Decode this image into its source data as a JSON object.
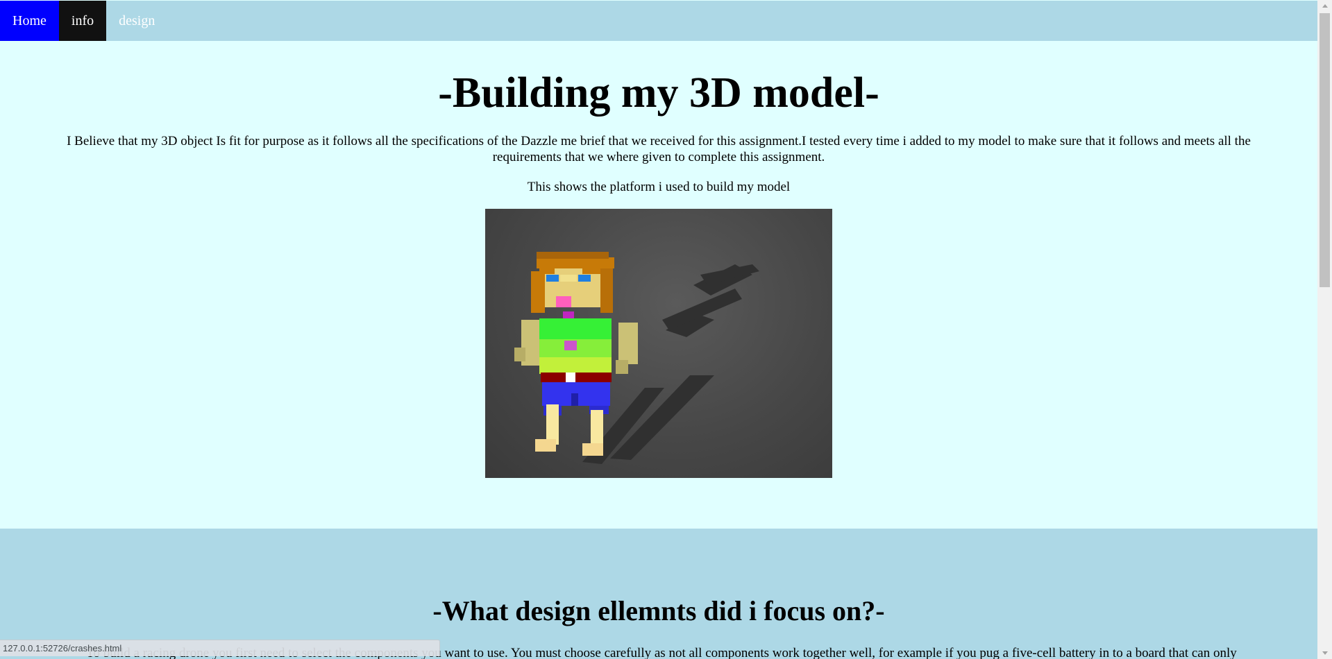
{
  "nav": {
    "items": [
      {
        "label": "Home"
      },
      {
        "label": "info"
      },
      {
        "label": "design"
      }
    ]
  },
  "section1": {
    "title": "-Building my 3D model-",
    "paragraph": "I Believe that my 3D object Is fit for purpose as it follows all the specifications of the Dazzle me brief that we received for this assignment.I tested every time i added to my model to make sure that it follows and meets all the requirements that we where given to complete this assignment.",
    "caption": "This shows the platform i used to build my model"
  },
  "section2": {
    "title": "-What design ellemnts did i focus on?-",
    "paragraph": "To build a racing drone you first need to select the components you want to use. You must choose carefully as not all components work together well, for example if you pug a five-cell battery in to a board that can only"
  },
  "status_bar": {
    "url": "127.0.0.1:52726/crashes.html"
  },
  "colors": {
    "nav_bg": "#add8e6",
    "home_bg": "#0000ff",
    "info_bg": "#111111",
    "page_bg": "#e0ffff"
  }
}
